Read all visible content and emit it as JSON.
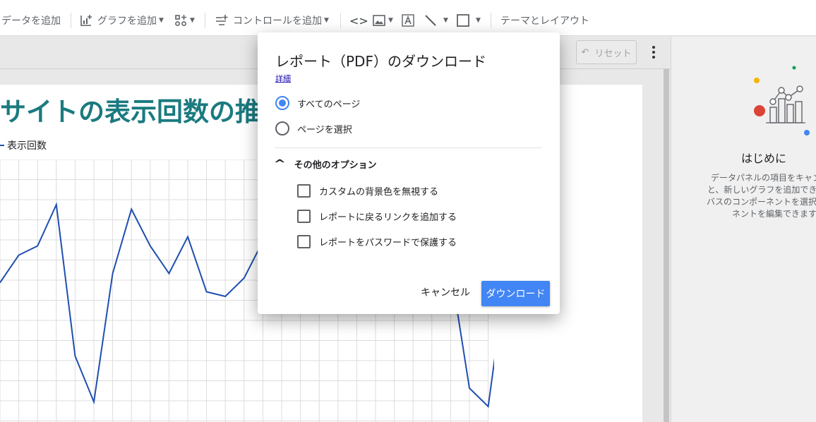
{
  "toolbar": {
    "add_data": "データを追加",
    "add_chart": "グラフを追加",
    "add_control": "コントロールを追加",
    "theme_layout": "テーマとレイアウト"
  },
  "subbar": {
    "reset": "リセット"
  },
  "report": {
    "title": "サイトの表示回数の推移",
    "legend": "表示回数",
    "line_color": "#1f4fb0"
  },
  "chart_data": {
    "type": "line",
    "title": "サイトの表示回数の推移",
    "series": [
      {
        "name": "表示回数",
        "values": [
          2.7,
          3.3,
          3.5,
          4.4,
          1.1,
          0.1,
          2.9,
          4.3,
          3.5,
          2.9,
          3.7,
          2.5,
          2.4,
          2.8,
          3.6,
          null,
          null,
          null,
          null,
          null,
          null,
          null,
          null,
          null,
          3.0,
          0.4,
          0.0,
          3.0,
          1.4,
          3.2
        ]
      }
    ],
    "grid": true,
    "legend_position": "top-left"
  },
  "right_panel": {
    "title": "はじめに",
    "desc_lines": [
      "データパネルの項目をキャンバス",
      "と、新しいグラフを追加できます。",
      "バスのコンポーネントを選択すると",
      "ネントを編集できます"
    ]
  },
  "dialog": {
    "title": "レポート（PDF）のダウンロード",
    "details_link": "詳細",
    "radio_all": "すべてのページ",
    "radio_select": "ページを選択",
    "selected_radio": "すべてのページ",
    "options_header": "その他のオプション",
    "opt_ignore_bg": "カスタムの背景色を無視する",
    "opt_add_link": "レポートに戻るリンクを追加する",
    "opt_password": "レポートをパスワードで保護する",
    "cancel": "キャンセル",
    "download": "ダウンロード",
    "accent": "#4285f4"
  }
}
